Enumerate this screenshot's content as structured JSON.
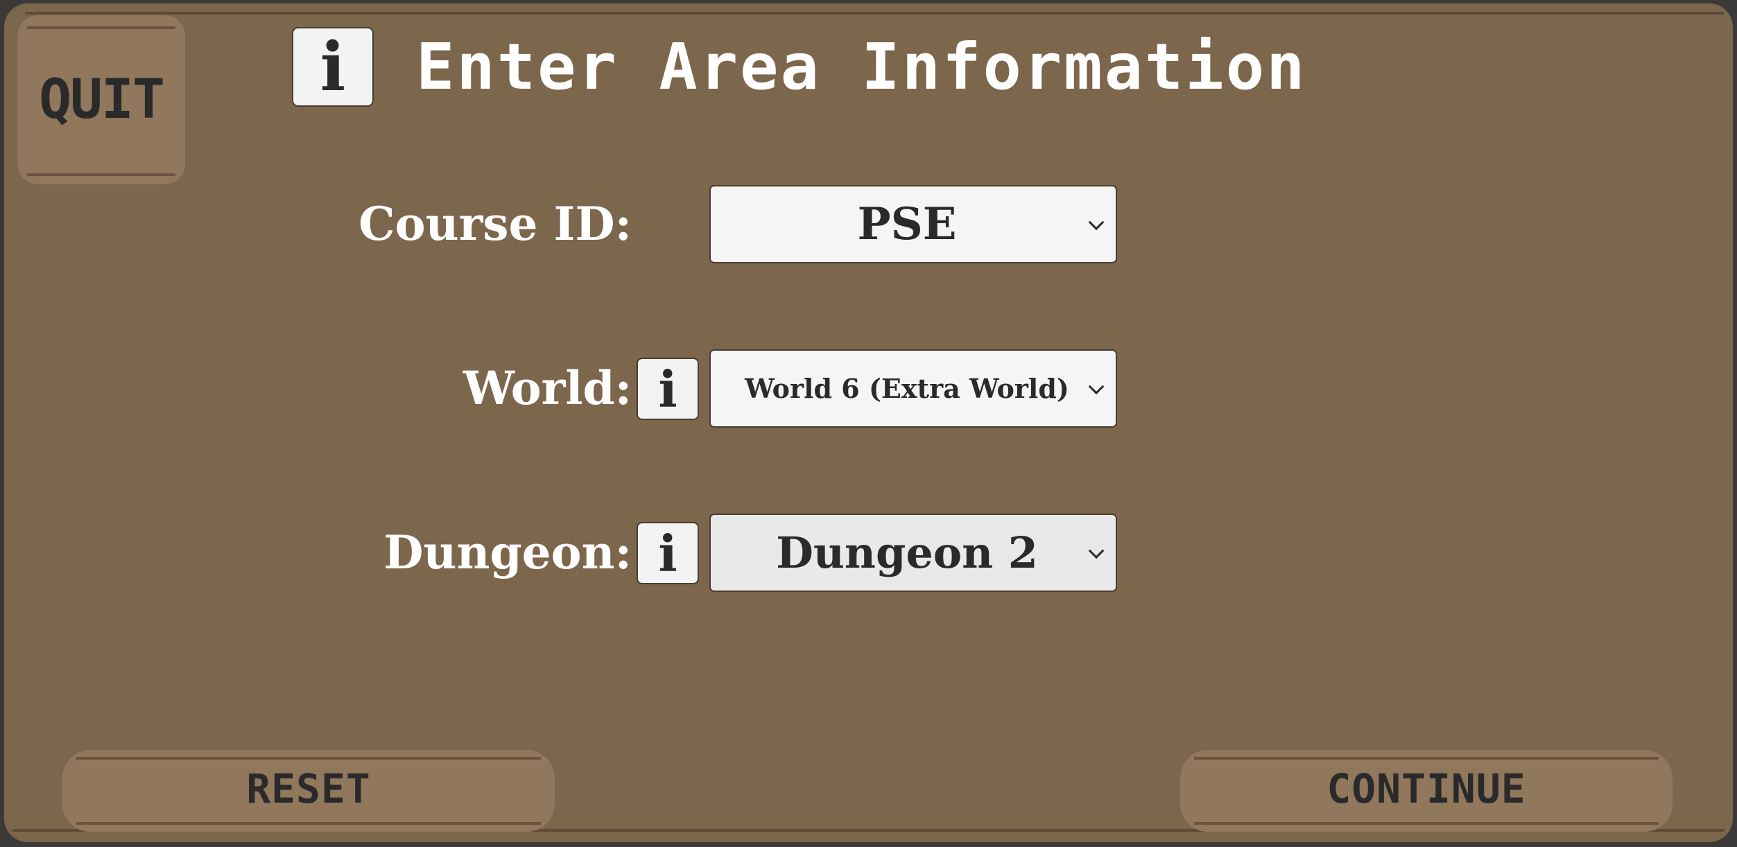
{
  "quit_button": {
    "label": "QUIT"
  },
  "header": {
    "info_symbol": "i",
    "title": "Enter Area Information"
  },
  "form": {
    "course": {
      "label": "Course ID:",
      "selected": "PSE"
    },
    "world": {
      "label": "World:",
      "info_symbol": "i",
      "selected": "World 6 (Extra World)"
    },
    "dungeon": {
      "label": "Dungeon:",
      "info_symbol": "i",
      "selected": "Dungeon 2"
    }
  },
  "footer": {
    "reset_label": "RESET",
    "continue_label": "CONTINUE"
  },
  "icons": {
    "info": "info-icon",
    "dropdown": "chevron-down-icon"
  },
  "colors": {
    "panel_background": "#7c664c",
    "button_background": "#91775b",
    "field_background": "#f5f5f5",
    "text_dark": "#2a2a2a",
    "text_light": "#ffffff"
  }
}
